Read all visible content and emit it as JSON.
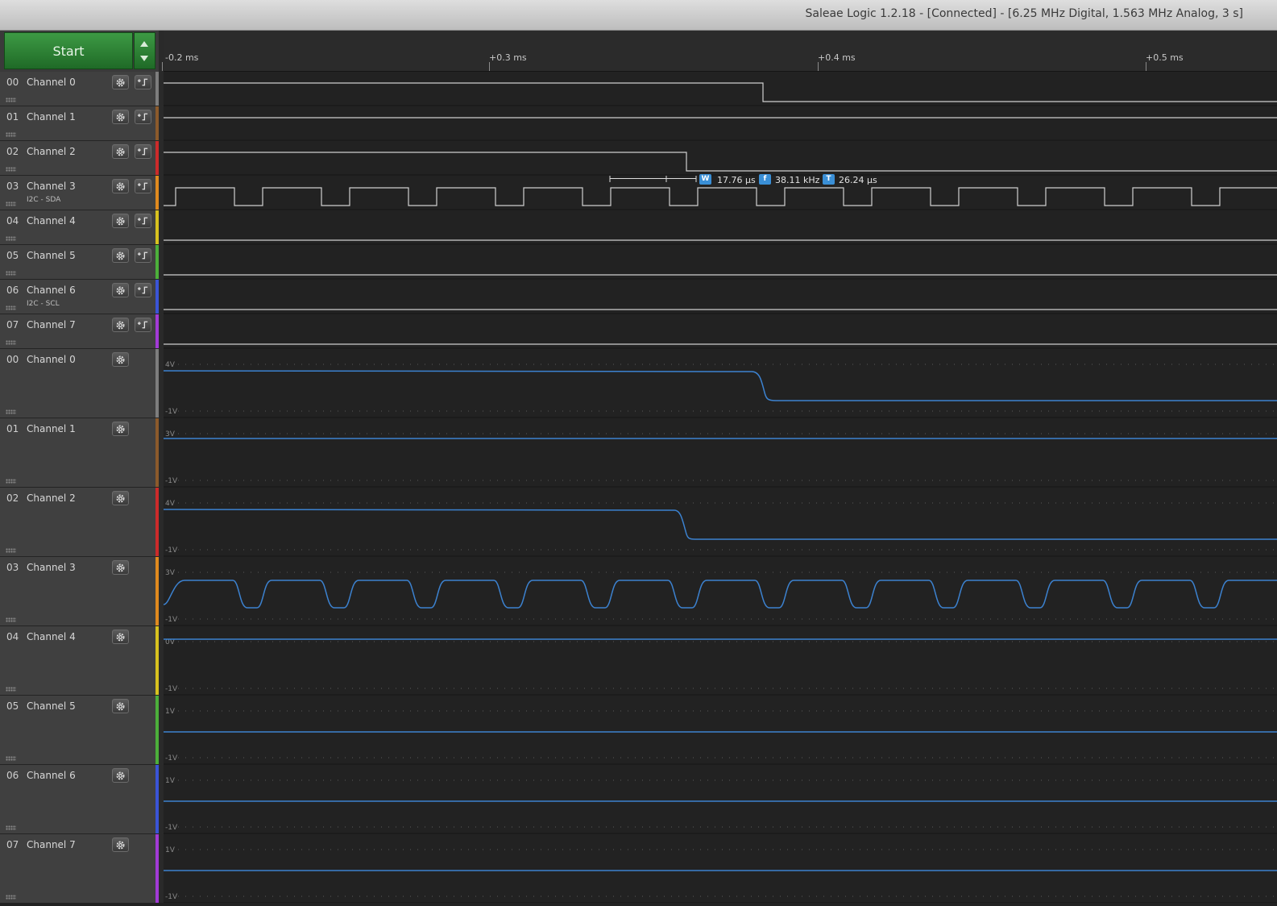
{
  "window": {
    "title": "Saleae Logic 1.2.18 - [Connected] - [6.25 MHz Digital, 1.563 MHz Analog, 3 s]"
  },
  "controls": {
    "start_label": "Start"
  },
  "timeline": {
    "labels": [
      "-0.2 ms",
      "+0.3 ms",
      "+0.4 ms",
      "+0.5 ms"
    ]
  },
  "digital_channels": [
    {
      "num": "00",
      "name": "Channel 0",
      "sub": "",
      "color": "#7d7d7d"
    },
    {
      "num": "01",
      "name": "Channel 1",
      "sub": "",
      "color": "#8b5a2b"
    },
    {
      "num": "02",
      "name": "Channel 2",
      "sub": "",
      "color": "#cc2a2a"
    },
    {
      "num": "03",
      "name": "Channel 3",
      "sub": "I2C - SDA",
      "color": "#e08a1e"
    },
    {
      "num": "04",
      "name": "Channel 4",
      "sub": "",
      "color": "#d8c21e"
    },
    {
      "num": "05",
      "name": "Channel 5",
      "sub": "",
      "color": "#4caf3a"
    },
    {
      "num": "06",
      "name": "Channel 6",
      "sub": "I2C - SCL",
      "color": "#3a54d6"
    },
    {
      "num": "07",
      "name": "Channel 7",
      "sub": "",
      "color": "#a23ad6"
    }
  ],
  "analog_channels": [
    {
      "num": "00",
      "name": "Channel 0",
      "vmax": "4V",
      "vmin": "-1V"
    },
    {
      "num": "01",
      "name": "Channel 1",
      "vmax": "3V",
      "vmin": "-1V"
    },
    {
      "num": "02",
      "name": "Channel 2",
      "vmax": "4V",
      "vmin": "-1V"
    },
    {
      "num": "03",
      "name": "Channel 3",
      "vmax": "3V",
      "vmin": "-1V"
    },
    {
      "num": "04",
      "name": "Channel 4",
      "vmax": "0V",
      "vmin": "-1V"
    },
    {
      "num": "05",
      "name": "Channel 5",
      "vmax": "1V",
      "vmin": "-1V"
    },
    {
      "num": "06",
      "name": "Channel 6",
      "vmax": "1V",
      "vmin": "-1V"
    },
    {
      "num": "07",
      "name": "Channel 7",
      "vmax": "1V",
      "vmin": "-1V"
    }
  ],
  "measurement": {
    "width_icon": "W",
    "width": "17.76 µs",
    "freq_icon": "f",
    "freq": "38.11 kHz",
    "period_icon": "T",
    "period": "26.24 µs"
  },
  "colors": {
    "digital_trace": "#d0d0d0",
    "analog_trace": "#3c82d0",
    "accent_green": "#2e8a36"
  }
}
